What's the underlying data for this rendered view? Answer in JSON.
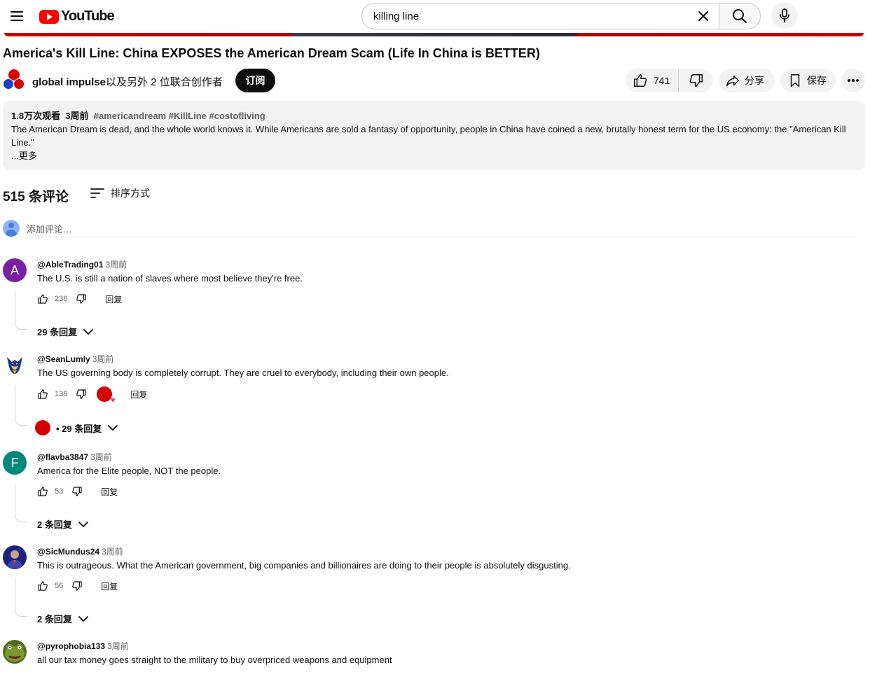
{
  "header": {
    "logo_text": "YouTube",
    "search_value": "killing line"
  },
  "video": {
    "title": "America's Kill Line: China EXPOSES the American Dream Scam (Life In China is BETTER)",
    "channel_name": "global impulse",
    "channel_suffix": "以及另外 2 位联合创作者",
    "subscribe_label": "订阅",
    "likes": "741",
    "share_label": "分享",
    "save_label": "保存"
  },
  "description": {
    "views": "1.8万次观看",
    "age": "3周前",
    "tags": "#americandream #KillLine #costofliving",
    "text": "The American Dream is dead, and the whole world knows it. While Americans are sold a fantasy of opportunity, people in China have coined a new, brutally honest term for the US economy: the \"American Kill Line.\"",
    "more_label": "...更多"
  },
  "comments_section": {
    "count_label": "515 条评论",
    "sort_label": "排序方式",
    "add_placeholder": "添加评论…",
    "reply_label": "回复",
    "comments": [
      {
        "author": "@AbleTrading01",
        "time": "3周前",
        "avatar_letter": "A",
        "avatar_color": "#7b1fa2",
        "text": "The U.S. is still a nation of slaves where most believe they're free.",
        "likes": "236",
        "replies": "29 条回复"
      },
      {
        "author": "@SeanLumly",
        "time": "3周前",
        "avatar_letter": "",
        "avatar_color": "#1e3a8a",
        "text": "The US governing body is completely corrupt. They are cruel to everybody, including their own people.",
        "likes": "136",
        "replies": "• 29 条回复"
      },
      {
        "author": "@flavba3847",
        "time": "3周前",
        "avatar_letter": "F",
        "avatar_color": "#00897b",
        "text": "America for the Elite people, NOT the people.",
        "likes": "53",
        "replies": "2 条回复"
      },
      {
        "author": "@SicMundus24",
        "time": "3周前",
        "avatar_letter": "",
        "avatar_color": "#1a237e",
        "text": "This is outrageous. What the American government, big companies and billionaires are doing to their people is absolutely disgusting.",
        "likes": "56",
        "replies": "2 条回复"
      },
      {
        "author": "@pyrophobia133",
        "time": "3周前",
        "avatar_letter": "",
        "avatar_color": "#4e6b1f",
        "text": "all our tax money goes straight to the military to buy overpriced weapons and equipment",
        "likes": "",
        "replies": ""
      }
    ]
  },
  "colors": {
    "brand_red": "#ff0000",
    "text_primary": "#0f0f0f",
    "text_secondary": "#606060",
    "pill_bg": "#f2f2f2"
  },
  "icons": {
    "menu": "hamburger-icon",
    "clear": "close-icon",
    "search": "search-icon",
    "mic": "mic-icon",
    "like": "thumb-up-icon",
    "dislike": "thumb-down-icon",
    "share": "share-arrow-icon",
    "save": "bookmark-icon",
    "more": "more-horiz-icon",
    "sort": "sort-icon",
    "expand": "chevron-down-icon"
  }
}
